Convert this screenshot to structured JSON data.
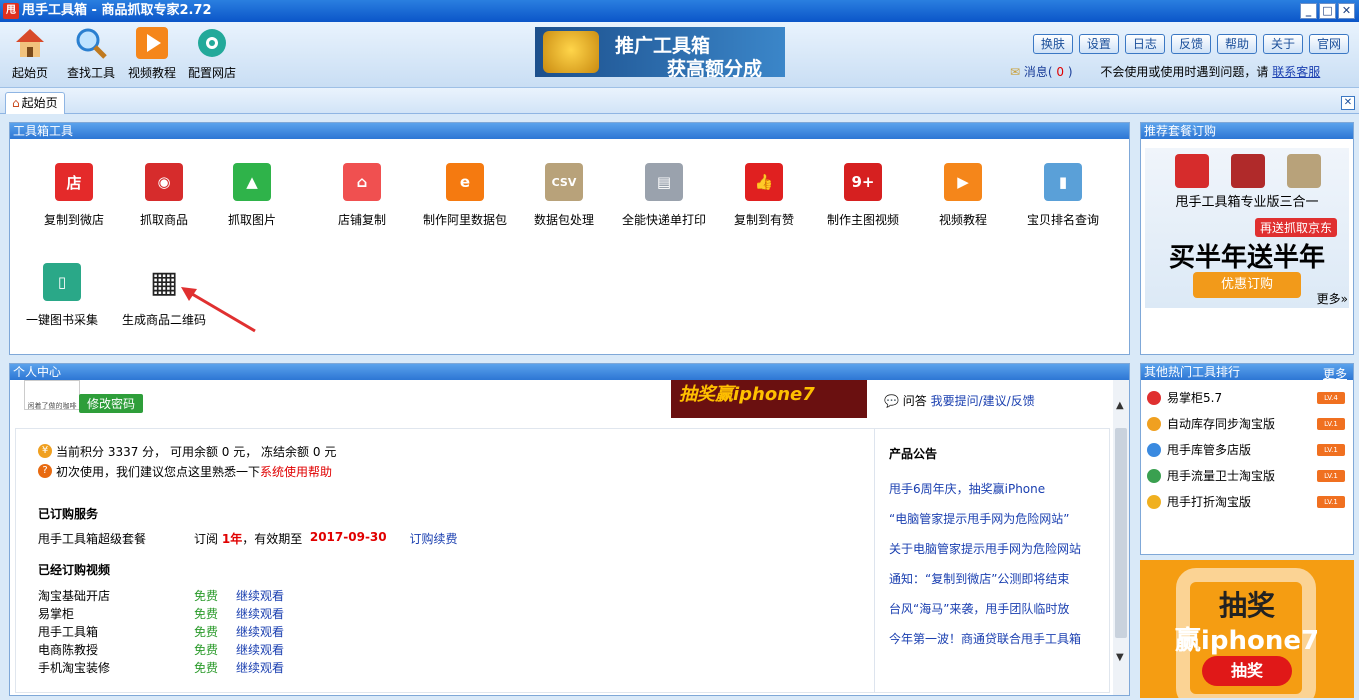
{
  "window": {
    "title": "甩手工具箱 - 商品抓取专家2.72",
    "app_icon_text": "甩"
  },
  "toolbar": {
    "items": [
      {
        "label": "起始页",
        "icon": "home-icon"
      },
      {
        "label": "查找工具",
        "icon": "search-icon"
      },
      {
        "label": "视频教程",
        "icon": "play-icon"
      },
      {
        "label": "配置网店",
        "icon": "gear-icon"
      }
    ],
    "banner": {
      "line1": "推广工具箱",
      "line2": "获高额分成"
    },
    "top_buttons": [
      "换肤",
      "设置",
      "日志",
      "反馈",
      "帮助",
      "关于",
      "官网"
    ],
    "message_label": "消息(",
    "message_count": "0",
    "message_close": ")",
    "help_text": "不会使用或使用时遇到问题，请",
    "help_link": "联系客服"
  },
  "tabs": [
    {
      "label": "起始页"
    }
  ],
  "tools_panel": {
    "title": "工具箱工具",
    "tools": [
      {
        "label": "复制到微店",
        "icon": "shop-icon",
        "color": "#e42a2a",
        "glyph": "店"
      },
      {
        "label": "抓取商品",
        "icon": "spider-icon",
        "color": "#d62c2c",
        "glyph": "◉"
      },
      {
        "label": "抓取图片",
        "icon": "image-icon",
        "color": "#2fb34a",
        "glyph": "▲"
      },
      {
        "label": "店铺复制",
        "icon": "store-icon",
        "color": "#f05050",
        "glyph": "⌂"
      },
      {
        "label": "制作阿里数据包",
        "icon": "alibaba-icon",
        "color": "#f57a10",
        "glyph": "e"
      },
      {
        "label": "数据包处理",
        "icon": "csv-icon",
        "color": "#b8a27a",
        "glyph": "CSV"
      },
      {
        "label": "全能快递单打印",
        "icon": "printer-icon",
        "color": "#9aa2ad",
        "glyph": "▤"
      },
      {
        "label": "复制到有赞",
        "icon": "thumbs-up-icon",
        "color": "#e02020",
        "glyph": "👍"
      },
      {
        "label": "制作主图视频",
        "icon": "video-icon",
        "color": "#d62020",
        "glyph": "9+"
      },
      {
        "label": "视频教程",
        "icon": "play-icon",
        "color": "#f5861a",
        "glyph": "▶"
      },
      {
        "label": "宝贝排名查询",
        "icon": "rank-chart-icon",
        "color": "#5aa0d8",
        "glyph": "▮"
      },
      {
        "label": "一键图书采集",
        "icon": "book-icon",
        "color": "#2aa888",
        "glyph": "▯"
      },
      {
        "label": "生成商品二维码",
        "icon": "qrcode-icon",
        "color": "#222222",
        "glyph": "▦"
      }
    ]
  },
  "subscription_panel": {
    "title": "推荐套餐订购",
    "product": "甩手工具箱专业版三合一",
    "ribbon": "再送抓取京东",
    "headline": "买半年送半年",
    "button": "优惠订购",
    "more": "更多»"
  },
  "personal_panel": {
    "title": "个人中心",
    "avatar_caption": "闲着了做的咖啡",
    "change_password": "修改密码",
    "ad_text": "抽奖赢iphone7",
    "qa_label": "问答",
    "qa_link": "我要提问/建议/反馈",
    "points_line": "当前积分 3337 分， 可用余额 0 元， 冻结余额 0 元",
    "first_use_prefix": "初次使用，我们建议您点这里熟悉一下",
    "first_use_link": "系统使用帮助",
    "subscribed_services_title": "已订购服务",
    "service": {
      "name": "甩手工具箱超级套餐",
      "prefix": "订阅",
      "duration": "1年",
      "mid": "，有效期至",
      "expiry": "2017-09-30",
      "renew": "订购续费"
    },
    "subscribed_videos_title": "已经订购视频",
    "videos": [
      {
        "name": "淘宝基础开店",
        "price": "免费",
        "action": "继续观看"
      },
      {
        "name": "易掌柜",
        "price": "免费",
        "action": "继续观看"
      },
      {
        "name": "甩手工具箱",
        "price": "免费",
        "action": "继续观看"
      },
      {
        "name": "电商陈教授",
        "price": "免费",
        "action": "继续观看"
      },
      {
        "name": "手机淘宝装修",
        "price": "免费",
        "action": "继续观看"
      }
    ],
    "announcements_title": "产品公告",
    "announcements": [
      "甩手6周年庆，抽奖赢iPhone",
      "“电脑管家提示甩手网为危险网站”",
      "关于电脑管家提示甩手网为危险网站",
      "通知：“复制到微店”公测即将结束",
      "台风“海马”来袭，甩手团队临时放",
      "今年第一波！商通贷联合甩手工具箱"
    ]
  },
  "rank_panel": {
    "title": "其他热门工具排行",
    "more": "更多",
    "items": [
      {
        "label": "易掌柜5.7",
        "level": "LV.4",
        "color": "#e03030"
      },
      {
        "label": "自动库存同步淘宝版",
        "level": "LV.1",
        "color": "#f0a020"
      },
      {
        "label": "甩手库管多店版",
        "level": "LV.1",
        "color": "#3a8ae0"
      },
      {
        "label": "甩手流量卫士淘宝版",
        "level": "LV.1",
        "color": "#3aa050"
      },
      {
        "label": "甩手打折淘宝版",
        "level": "LV.1",
        "color": "#f0b020"
      }
    ]
  },
  "promo": {
    "line1": "抽奖",
    "line2": "赢iphone7",
    "button": "抽奖"
  }
}
